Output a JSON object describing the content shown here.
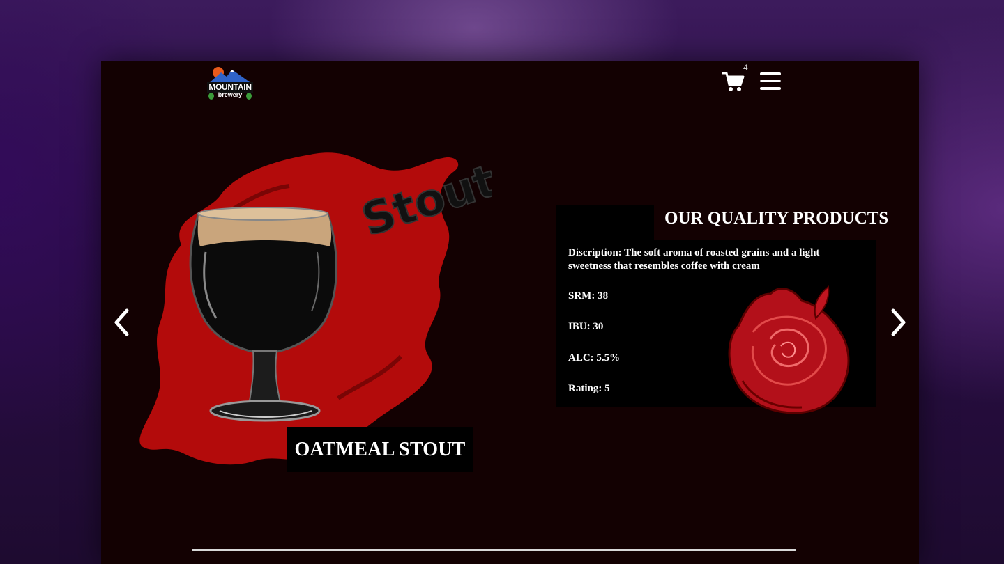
{
  "header": {
    "logo_title": "MOUNTAIN",
    "logo_subtitle": "brewery",
    "cart_count": "4"
  },
  "hero": {
    "beer_name": "OATMEAL STOUT",
    "glass_lettering": "Stout"
  },
  "product_info": {
    "title": "OUR QUALITY PRODUCTS",
    "description": "Discription: The soft aroma of roasted grains and a light sweetness that resembles coffee with cream",
    "srm": "SRM: 38",
    "ibu": "IBU: 30",
    "alc": "ALC: 5.5%",
    "rating": "Rating: 5"
  },
  "icons": {
    "cart": "cart-icon",
    "menu": "hamburger-menu-icon",
    "prev": "chevron-left-icon",
    "next": "chevron-right-icon"
  },
  "colors": {
    "page_bg": "#130102",
    "accent_red": "#b30b0b",
    "panel_bg": "#000000",
    "text": "#ffffff"
  }
}
